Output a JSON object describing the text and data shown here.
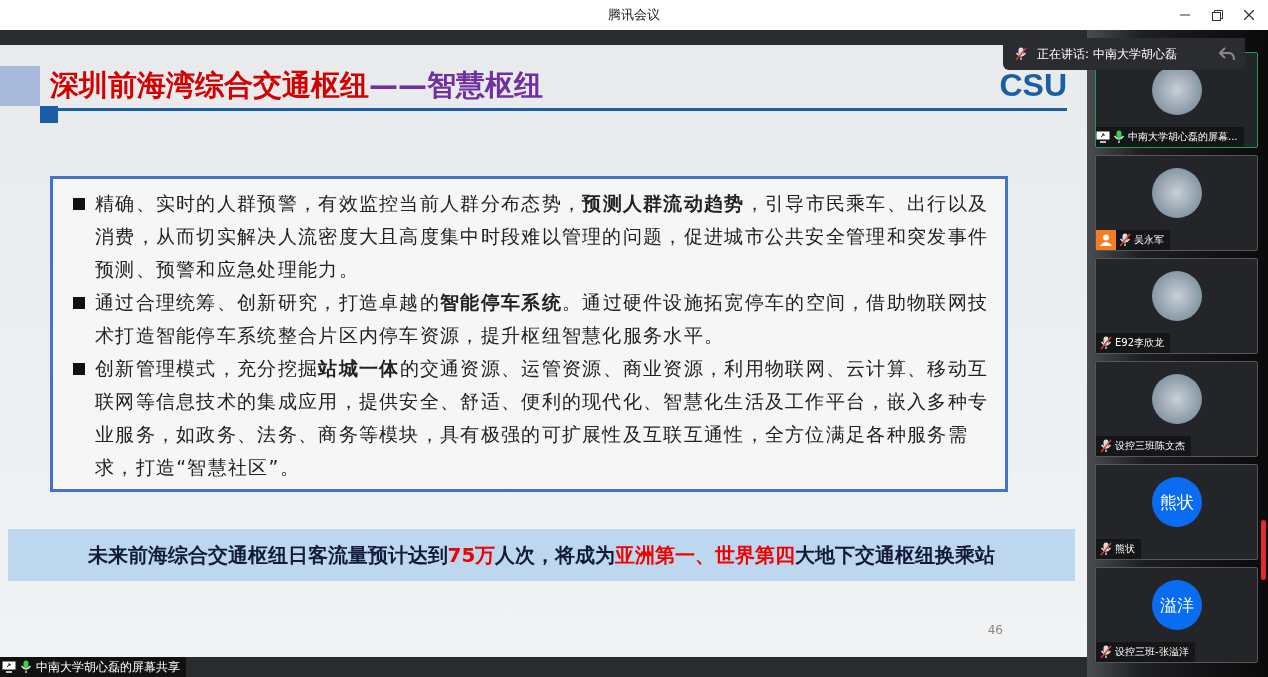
{
  "window": {
    "title": "腾讯会议"
  },
  "speaker_banner": {
    "text": "正在讲话: 中南大学胡心磊"
  },
  "slide": {
    "title": "深圳前海湾综合交通枢纽",
    "subtitle": "——智慧枢纽",
    "logo": "CSU",
    "bullets": [
      "精确、实时的人群预警，有效监控当前人群分布态势，**预测人群流动趋势**，引导市民乘车、出行以及消费，从而切实解决人流密度大且高度集中时段难以管理的问题，促进城市公共安全管理和突发事件预测、预警和应急处理能力。",
      "通过合理统筹、创新研究，打造卓越的**智能停车系统**。通过硬件设施拓宽停车的空间，借助物联网技术打造智能停车系统整合片区内停车资源，提升枢纽智慧化服务水平。",
      "创新管理模式，充分挖掘**站城一体**的交通资源、运管资源、商业资源，利用物联网、云计算、移动互联网等信息技术的集成应用，提供安全、舒适、便利的现代化、智慧化生活及工作平台，嵌入多种专业服务，如政务、法务、商务等模块，具有极强的可扩展性及互联互通性，全方位满足各种服务需求，打造“智慧社区”。"
    ],
    "banner": [
      {
        "text": "未来前海综合交通枢纽日客流量预计达到",
        "highlight": false
      },
      {
        "text": "75万",
        "highlight": true
      },
      {
        "text": "人次，将成为",
        "highlight": false
      },
      {
        "text": "亚洲第一、世界第四",
        "highlight": true
      },
      {
        "text": "大地下交通枢纽换乘站",
        "highlight": false
      }
    ],
    "page_number": "46"
  },
  "participants": [
    {
      "name": "中南大学胡心磊的屏幕...",
      "avatar": {
        "kind": "photo"
      },
      "muted": false,
      "sharing": true,
      "selected": true
    },
    {
      "name": "吴永军",
      "avatar": {
        "kind": "photo"
      },
      "muted": true,
      "sharing": false,
      "selected": false,
      "badge": true
    },
    {
      "name": "E92李欣龙",
      "avatar": {
        "kind": "photo"
      },
      "muted": true,
      "sharing": false,
      "selected": false
    },
    {
      "name": "设控三班陈文杰",
      "avatar": {
        "kind": "photo"
      },
      "muted": true,
      "sharing": false,
      "selected": false
    },
    {
      "name": "熊状",
      "avatar": {
        "kind": "initials",
        "text": "熊状"
      },
      "muted": true,
      "sharing": false,
      "selected": false
    },
    {
      "name": "设控三班-张溢洋",
      "avatar": {
        "kind": "initials",
        "text": "溢洋"
      },
      "muted": true,
      "sharing": false,
      "selected": false
    }
  ],
  "share_status": {
    "text": "中南大学胡心磊的屏幕共享",
    "muted": false
  }
}
